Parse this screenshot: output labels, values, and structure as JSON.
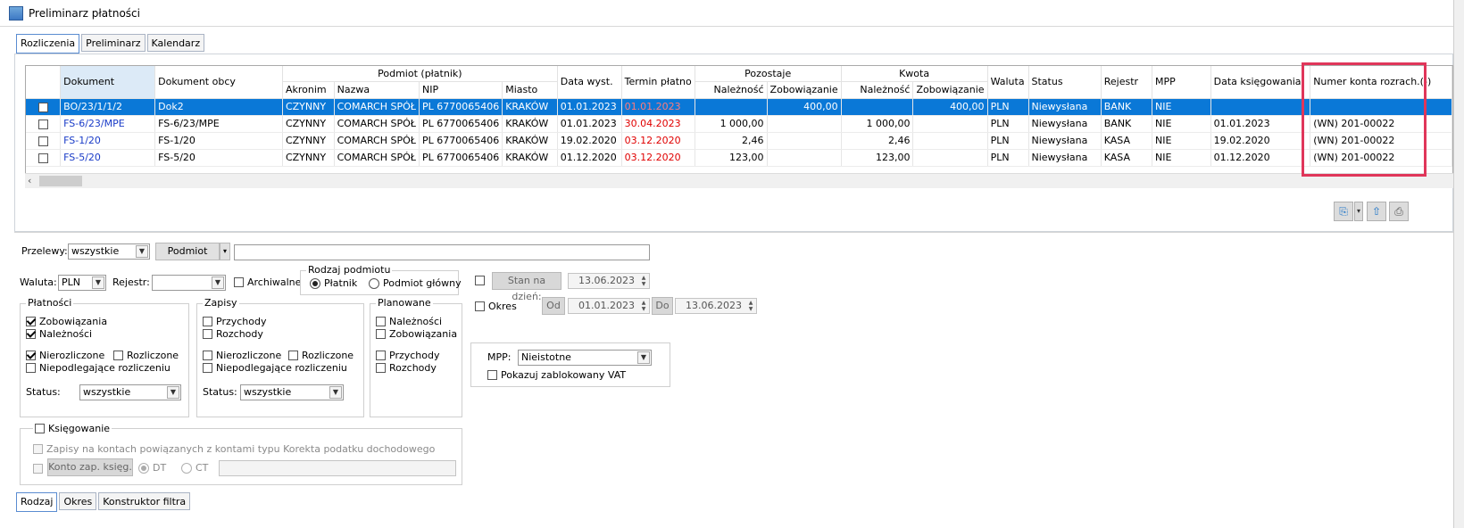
{
  "window": {
    "title": "Preliminarz płatności"
  },
  "tabs_top": [
    {
      "label": "Rozliczenia",
      "active": true
    },
    {
      "label": "Preliminarz",
      "active": false
    },
    {
      "label": "Kalendarz",
      "active": false
    }
  ],
  "grid": {
    "group_headers": {
      "podmiot": "Podmiot (płatnik)",
      "pozostaje": "Pozostaje",
      "kwota": "Kwota"
    },
    "headers": {
      "dokument": "Dokument",
      "dokument_obcy": "Dokument obcy",
      "akronim": "Akronim",
      "nazwa": "Nazwa",
      "nip": "NIP",
      "miasto": "Miasto",
      "data_wyst": "Data wyst.",
      "termin": "Termin płatno",
      "poz_naleznosc": "Należność",
      "poz_zobowiazanie": "Zobowiązanie",
      "kw_naleznosc": "Należność",
      "kw_zobowiazanie": "Zobowiązanie",
      "waluta": "Waluta",
      "status": "Status",
      "rejestr": "Rejestr",
      "mpp": "MPP",
      "data_ksieg": "Data księgowania",
      "numer_konta": "Numer konta rozrach.(-)"
    },
    "rows": [
      {
        "dok": "BO/23/1/1/2",
        "obcy": "Dok2",
        "akronim": "CZYNNY",
        "nazwa": "COMARCH SPÓŁ",
        "nip": "PL 6770065406",
        "miasto": "KRAKÓW",
        "data": "01.01.2023",
        "termin": "01.01.2023",
        "pn": "",
        "pz": "400,00",
        "kn": "",
        "kz": "400,00",
        "waluta": "PLN",
        "status": "Niewysłana",
        "rejestr": "BANK",
        "mpp": "NIE",
        "dk": "",
        "konto": ""
      },
      {
        "dok": "FS-6/23/MPE",
        "obcy": "FS-6/23/MPE",
        "akronim": "CZYNNY",
        "nazwa": "COMARCH SPÓŁ",
        "nip": "PL 6770065406",
        "miasto": "KRAKÓW",
        "data": "01.01.2023",
        "termin": "30.04.2023",
        "pn": "1 000,00",
        "pz": "",
        "kn": "1 000,00",
        "kz": "",
        "waluta": "PLN",
        "status": "Niewysłana",
        "rejestr": "BANK",
        "mpp": "NIE",
        "dk": "01.01.2023",
        "konto": "(WN) 201-00022"
      },
      {
        "dok": "FS-1/20",
        "obcy": "FS-1/20",
        "akronim": "CZYNNY",
        "nazwa": "COMARCH SPÓŁ",
        "nip": "PL 6770065406",
        "miasto": "KRAKÓW",
        "data": "19.02.2020",
        "termin": "03.12.2020",
        "pn": "2,46",
        "pz": "",
        "kn": "2,46",
        "kz": "",
        "waluta": "PLN",
        "status": "Niewysłana",
        "rejestr": "KASA",
        "mpp": "NIE",
        "dk": "19.02.2020",
        "konto": "(WN) 201-00022"
      },
      {
        "dok": "FS-5/20",
        "obcy": "FS-5/20",
        "akronim": "CZYNNY",
        "nazwa": "COMARCH SPÓŁ",
        "nip": "PL 6770065406",
        "miasto": "KRAKÓW",
        "data": "01.12.2020",
        "termin": "03.12.2020",
        "pn": "123,00",
        "pz": "",
        "kn": "123,00",
        "kz": "",
        "waluta": "PLN",
        "status": "Niewysłana",
        "rejestr": "KASA",
        "mpp": "NIE",
        "dk": "01.12.2020",
        "konto": "(WN) 201-00022"
      }
    ]
  },
  "filters": {
    "przelewy_label": "Przelewy:",
    "przelewy_value": "wszystkie",
    "podmiot_button": "Podmiot",
    "waluta_label": "Waluta:",
    "waluta_value": "PLN",
    "rejestr_label": "Rejestr:",
    "archiwalne": "Archiwalne",
    "rodzaj_podmiotu": "Rodzaj podmiotu",
    "platnik": "Płatnik",
    "podmiot_glowny": "Podmiot główny",
    "stan_na_dzien": "Stan na dzień:",
    "stan_date": "13.06.2023",
    "okres": "Okres",
    "od": "Od",
    "od_date": "01.01.2023",
    "do": "Do",
    "do_date": "13.06.2023",
    "platnosci": {
      "title": "Płatności",
      "zobowiazania": "Zobowiązania",
      "naleznosci": "Należności",
      "nierozliczone": "Nierozliczone",
      "rozliczone": "Rozliczone",
      "niepodlegajace": "Niepodlegające rozliczeniu",
      "status_label": "Status:",
      "status_value": "wszystkie"
    },
    "zapisy": {
      "title": "Zapisy",
      "przychody": "Przychody",
      "rozchody": "Rozchody",
      "nierozliczone": "Nierozliczone",
      "rozliczone": "Rozliczone",
      "niepodlegajace": "Niepodlegające rozliczeniu",
      "status_label": "Status:",
      "status_value": "wszystkie"
    },
    "planowane": {
      "title": "Planowane",
      "naleznosci": "Należności",
      "zobowiazania": "Zobowiązania",
      "przychody": "Przychody",
      "rozchody": "Rozchody"
    },
    "mpp_label": "MPP:",
    "mpp_value": "Nieistotne",
    "pokazuj_vat": "Pokazuj zablokowany VAT",
    "ksiegowanie": {
      "title": "Księgowanie",
      "zapisy_korekta": "Zapisy na kontach powiązanych z kontami typu Korekta podatku dochodowego",
      "konto_button": "Konto zap. księg.",
      "dt": "DT",
      "ct": "CT"
    }
  },
  "tabs_bottom": [
    {
      "label": "Rodzaj",
      "active": true
    },
    {
      "label": "Okres",
      "active": false
    },
    {
      "label": "Konstruktor filtra",
      "active": false
    }
  ],
  "colors": {
    "selection": "#0a78d7",
    "highlight_box": "#e0365a",
    "link": "#1a3cc8",
    "overdue": "#e00000"
  }
}
